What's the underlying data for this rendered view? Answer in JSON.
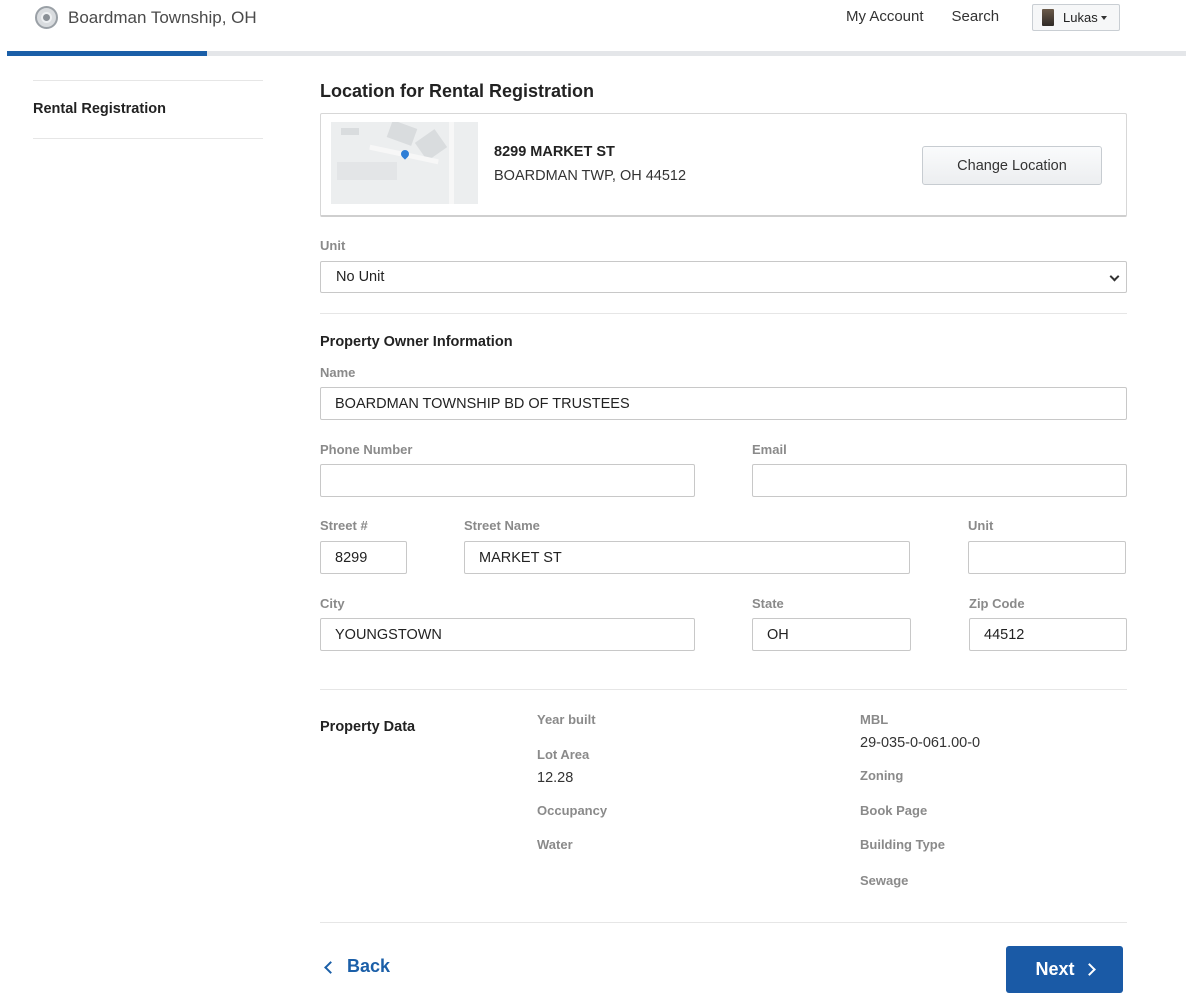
{
  "header": {
    "site_title": "Boardman Township, OH",
    "my_account": "My Account",
    "search": "Search",
    "user_name": "Lukas",
    "progress_percent": 17
  },
  "sidebar": {
    "items": [
      {
        "label": "Rental Registration"
      }
    ]
  },
  "location": {
    "section_title": "Location for Rental Registration",
    "address_line1": "8299 MARKET ST",
    "address_line2": "BOARDMAN TWP, OH 44512",
    "change_button": "Change Location"
  },
  "unit": {
    "label": "Unit",
    "selected": "No Unit"
  },
  "owner": {
    "section_title": "Property Owner Information",
    "name_label": "Name",
    "name_value": "BOARDMAN TOWNSHIP BD OF TRUSTEES",
    "phone_label": "Phone Number",
    "phone_value": "",
    "email_label": "Email",
    "email_value": "",
    "street_num_label": "Street #",
    "street_num_value": "8299",
    "street_name_label": "Street Name",
    "street_name_value": "MARKET ST",
    "unit_label": "Unit",
    "unit_value": "",
    "city_label": "City",
    "city_value": "YOUNGSTOWN",
    "state_label": "State",
    "state_value": "OH",
    "zip_label": "Zip Code",
    "zip_value": "44512"
  },
  "property_data": {
    "title": "Property Data",
    "year_built_label": "Year built",
    "year_built_value": "",
    "lot_area_label": "Lot Area",
    "lot_area_value": "12.28",
    "occupancy_label": "Occupancy",
    "water_label": "Water",
    "mbl_label": "MBL",
    "mbl_value": "29-035-0-061.00-0",
    "zoning_label": "Zoning",
    "book_page_label": "Book Page",
    "building_type_label": "Building Type",
    "sewage_label": "Sewage"
  },
  "footer": {
    "back_label": "Back",
    "next_label": "Next"
  }
}
